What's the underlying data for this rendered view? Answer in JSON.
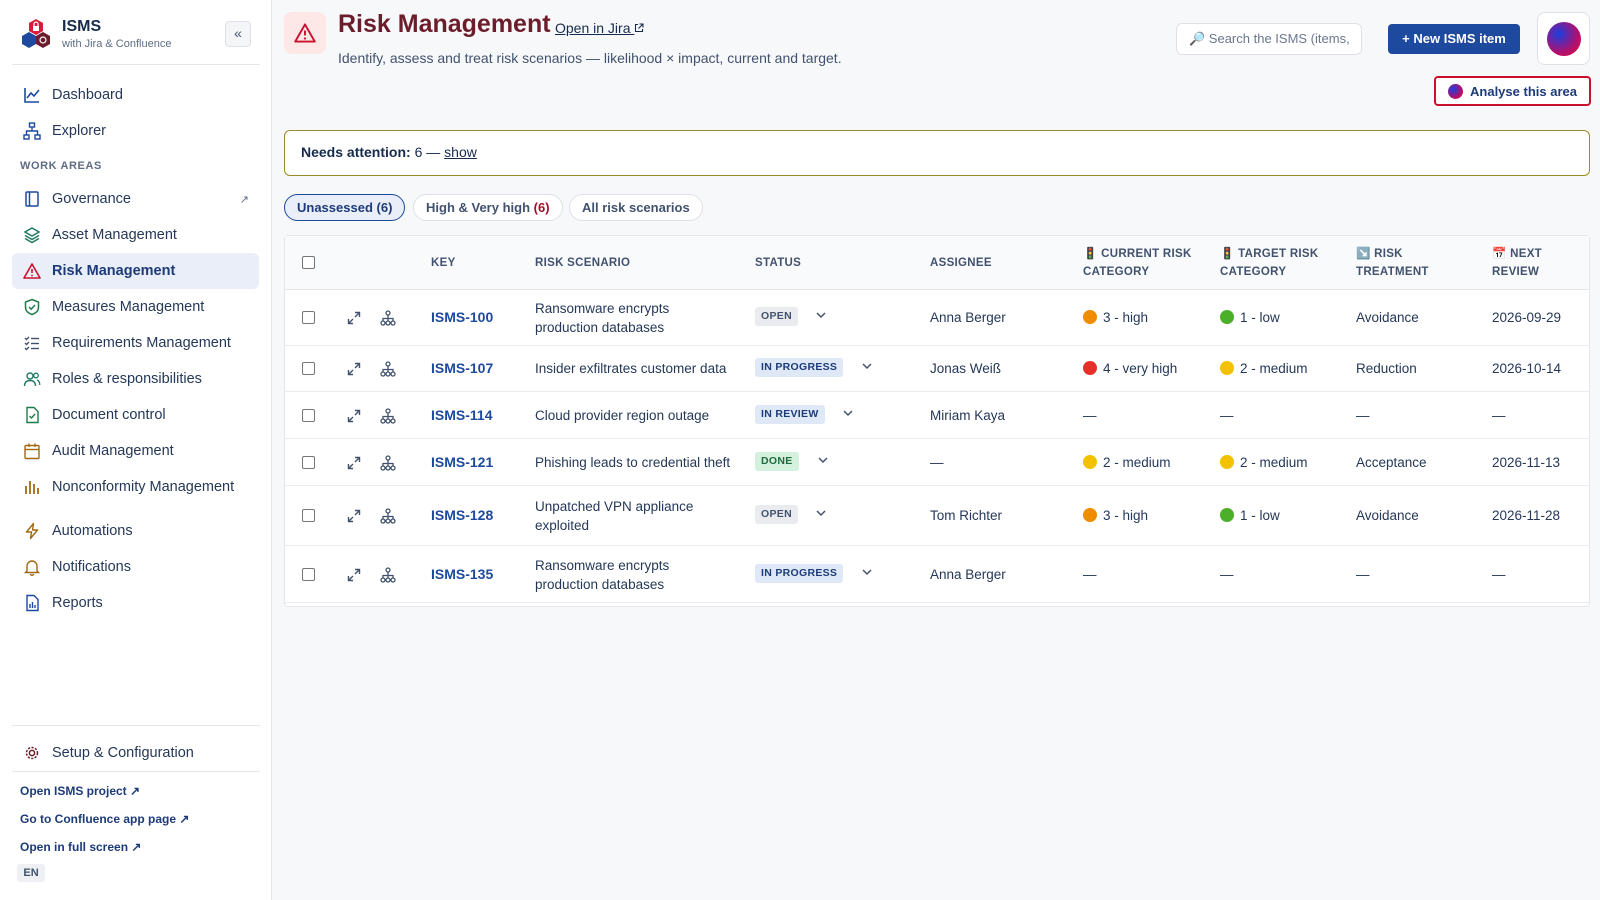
{
  "sidebar": {
    "brand_title": "ISMS",
    "brand_subtitle": "with Jira & Confluence",
    "collapse_label": "«",
    "items_top": [
      {
        "label": "Dashboard",
        "icon": "chart-line-icon"
      },
      {
        "label": "Explorer",
        "icon": "hierarchy-icon"
      }
    ],
    "section_label": "WORK AREAS",
    "work_areas": [
      {
        "label": "Governance",
        "icon": "book-icon",
        "external": "↗"
      },
      {
        "label": "Asset Management",
        "icon": "layers-icon"
      },
      {
        "label": "Risk Management",
        "icon": "warning-icon",
        "active": true
      },
      {
        "label": "Measures Management",
        "icon": "shield-check-icon"
      },
      {
        "label": "Requirements Management",
        "icon": "checklist-icon"
      },
      {
        "label": "Roles & responsibilities",
        "icon": "users-icon"
      },
      {
        "label": "Document control",
        "icon": "document-check-icon"
      },
      {
        "label": "Audit Management",
        "icon": "calendar-icon"
      },
      {
        "label": "Nonconformity Management",
        "icon": "bar-chart-icon"
      }
    ],
    "items_bottom": [
      {
        "label": "Automations",
        "icon": "bolt-icon"
      },
      {
        "label": "Notifications",
        "icon": "bell-icon"
      },
      {
        "label": "Reports",
        "icon": "report-icon"
      }
    ],
    "setup_label": "Setup & Configuration",
    "links": [
      "Open ISMS project ↗",
      "Go to Confluence app page ↗",
      "Open in full screen ↗"
    ],
    "language": "EN"
  },
  "header": {
    "title": "Risk Management",
    "jira_link": "Open in Jira",
    "description": "Identify, assess and treat risk scenarios — likelihood × impact, current and target.",
    "search_placeholder": "🔎 Search the ISMS (items,",
    "new_button": "+ New ISMS item",
    "analyse_button": "Analyse this area"
  },
  "attention": {
    "label": "Needs attention:",
    "count": "6 —",
    "link": "show"
  },
  "filters": [
    {
      "label": "Unassessed",
      "count": "(6)",
      "active": true
    },
    {
      "label": "High & Very high",
      "count": "(6)",
      "active": false
    },
    {
      "label": "All risk scenarios",
      "count": "",
      "active": false
    }
  ],
  "table": {
    "columns": {
      "key": "KEY",
      "scenario": "RISK SCENARIO",
      "status": "STATUS",
      "assignee": "ASSIGNEE",
      "current_1": "🚦 CURRENT RISK",
      "current_2": "CATEGORY",
      "target_1": "🚦 TARGET RISK",
      "target_2": "CATEGORY",
      "treatment_1": "↘️ RISK",
      "treatment_2": "TREATMENT",
      "review_1": "📅 NEXT",
      "review_2": "REVIEW"
    },
    "rows": [
      {
        "key": "ISMS-100",
        "scenario_1": "Ransomware encrypts",
        "scenario_2": "production databases",
        "status": "OPEN",
        "assignee": "Anna Berger",
        "current": "3 - high",
        "current_color": "#f08c00",
        "target": "1 - low",
        "target_color": "#4caf2a",
        "treatment": "Avoidance",
        "review": "2026-09-29"
      },
      {
        "key": "ISMS-107",
        "scenario_1": "Insider exfiltrates customer data",
        "scenario_2": "",
        "status": "IN PROGRESS",
        "assignee": "Jonas Weiß",
        "current": "4 - very high",
        "current_color": "#e5302a",
        "target": "2 - medium",
        "target_color": "#f2c200",
        "treatment": "Reduction",
        "review": "2026-10-14"
      },
      {
        "key": "ISMS-114",
        "scenario_1": "Cloud provider region outage",
        "scenario_2": "",
        "status": "IN REVIEW",
        "assignee": "Miriam Kaya",
        "current": "—",
        "current_color": "",
        "target": "—",
        "target_color": "",
        "treatment": "—",
        "review": "—"
      },
      {
        "key": "ISMS-121",
        "scenario_1": "Phishing leads to credential theft",
        "scenario_2": "",
        "status": "DONE",
        "assignee": "—",
        "current": "2 - medium",
        "current_color": "#f2c200",
        "target": "2 - medium",
        "target_color": "#f2c200",
        "treatment": "Acceptance",
        "review": "2026-11-13"
      },
      {
        "key": "ISMS-128",
        "scenario_1": "Unpatched VPN appliance",
        "scenario_2": "exploited",
        "status": "OPEN",
        "assignee": "Tom Richter",
        "current": "3 - high",
        "current_color": "#f08c00",
        "target": "1 - low",
        "target_color": "#4caf2a",
        "treatment": "Avoidance",
        "review": "2026-11-28"
      },
      {
        "key": "ISMS-135",
        "scenario_1": "Ransomware encrypts",
        "scenario_2": "production databases",
        "status": "IN PROGRESS",
        "assignee": "Anna Berger",
        "current": "—",
        "current_color": "",
        "target": "—",
        "target_color": "",
        "treatment": "—",
        "review": "—"
      }
    ]
  }
}
